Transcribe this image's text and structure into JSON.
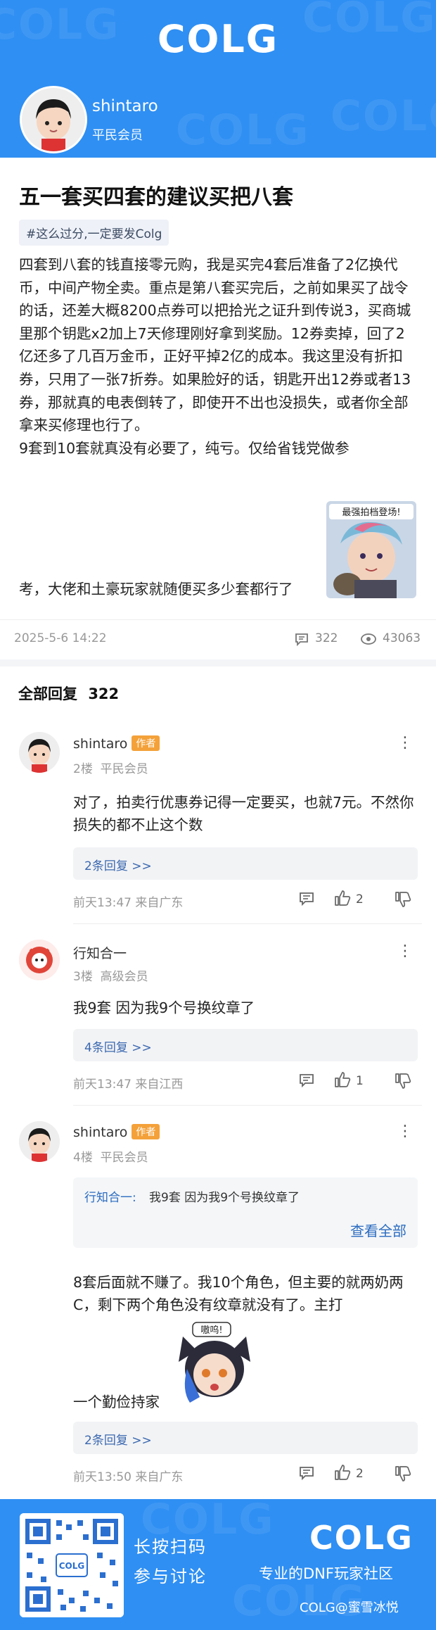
{
  "header": {
    "brand": "COLG",
    "username": "shintaro",
    "user_rank": "平民会员"
  },
  "post": {
    "title": "五一套买四套的建议买把八套",
    "tag": "#这么过分,一定要发Colg",
    "paragraph1": "四套到八套的钱直接零元购，我是买完4套后准备了2亿换代币，中间产物全卖。重点是第八套买完后，之前如果买了战令的话，还差大概8200点券可以把拾光之证升到传说3，买商城里那个钥匙x2加上7天修理刚好拿到奖励。12券卖掉，回了2亿还多了几百万金币，正好平掉2亿的成本。我这里没有折扣券，只用了一张7折券。如果脸好的话，钥匙开出12券或者13券，那就真的电表倒转了，即使开不出也没损失，或者你全部拿来买修理也行了。",
    "paragraph2a": "9套到10套就真没有必要了，纯亏。仅给省钱党做参",
    "sticker_caption": "最强拍档登场!",
    "paragraph2b": "考，大佬和土豪玩家就随便买多少套都行了",
    "date": "2025-5-6 14:22",
    "comments": "322",
    "views": "43063"
  },
  "replies_section": {
    "label": "全部回复",
    "count": "322"
  },
  "comments": [
    {
      "name": "shintaro",
      "badge": "作者",
      "floor": "2楼",
      "rank": "平民会员",
      "text": "对了，拍卖行优惠券记得一定要买，也就7元。不然你损失的都不止这个数",
      "reply_link": "2条回复 >>",
      "time": "前天13:47 来自广东",
      "likes": "2"
    },
    {
      "name": "行知合一",
      "floor": "3楼",
      "rank": "高级会员",
      "text": "我9套 因为我9个号换纹章了",
      "reply_link": "4条回复 >>",
      "time": "前天13:47 来自江西",
      "likes": "1"
    },
    {
      "name": "shintaro",
      "badge": "作者",
      "floor": "4楼",
      "rank": "平民会员",
      "quote_name": "行知合一:",
      "quote_text": "我9套 因为我9个号换纹章了",
      "quote_all": "查看全部",
      "text_a": "8套后面就不赚了。我10个角色，但主要的就两奶两C，剩下两个角色没有纹章就没有了。主打",
      "sticker_caption": "嗷呜!",
      "text_b": "一个勤俭持家",
      "reply_link": "2条回复 >>",
      "time": "前天13:50 来自广东",
      "likes": "2"
    }
  ],
  "footer": {
    "qr_label": "COLG",
    "line1": "长按扫码",
    "line2": "参与讨论",
    "brand": "COLG",
    "tagline": "专业的DNF玩家社区",
    "credit": "COLG@蜜雪冰悦"
  },
  "colors": {
    "brand_blue": "#2f8ff3",
    "badge_orange": "#f4a13a",
    "link_blue": "#3b68b0"
  },
  "icons": [
    "comment-icon",
    "eye-icon",
    "more-icon",
    "thumb-up-icon",
    "thumb-down-icon",
    "qr-code-icon"
  ]
}
